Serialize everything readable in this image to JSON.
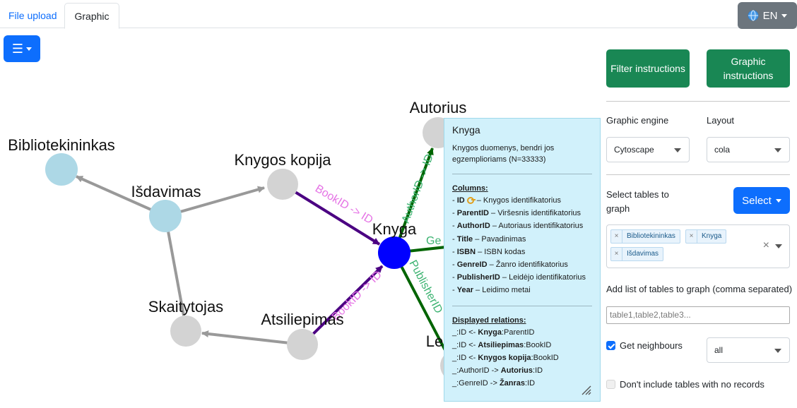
{
  "tabs": [
    {
      "label": "File upload"
    },
    {
      "label": "Graphic"
    }
  ],
  "language": {
    "icon": "globe-icon",
    "label": "EN"
  },
  "menu_button": {
    "icon": "hamburger-icon",
    "label": "☰"
  },
  "graph": {
    "nodes": [
      {
        "label": "Autorius",
        "color": "#d3d3d3"
      },
      {
        "label": "Bibliotekininkas",
        "color": "#add8e6"
      },
      {
        "label": "Knygos kopija",
        "color": "#d3d3d3"
      },
      {
        "label": "Išdavimas",
        "color": "#add8e6"
      },
      {
        "label": "Knyga",
        "color": "#0000ff"
      },
      {
        "label": "Skaitytojas",
        "color": "#d3d3d3"
      },
      {
        "label": "Atsiliepimas",
        "color": "#d3d3d3"
      },
      {
        "label": "Le",
        "color": "#d3d3d3"
      }
    ],
    "edge_labels": [
      {
        "text": "BookID -> ID",
        "color": "#e573e5"
      },
      {
        "text": "AuthorID -> ID",
        "color": "#3cb371"
      },
      {
        "text": "Ge",
        "color": "#3cb371"
      },
      {
        "text": "PublisherID",
        "color": "#3cb371"
      },
      {
        "text": "BookID -> ID",
        "color": "#e573e5"
      }
    ]
  },
  "tooltip": {
    "title": "Knyga",
    "description": "Knygos duomenys, bendri jos egzemplioriams (N=33333)",
    "columns_heading": "Columns:",
    "columns": [
      {
        "name": "ID",
        "desc": "Knygos identifikatorius",
        "key": true
      },
      {
        "name": "ParentID",
        "desc": "Viršesnis identifikatorius"
      },
      {
        "name": "AuthorID",
        "desc": "Autoriaus identifikatorius"
      },
      {
        "name": "Title",
        "desc": "Pavadinimas"
      },
      {
        "name": "ISBN",
        "desc": "ISBN kodas"
      },
      {
        "name": "GenreID",
        "desc": "Žanro identifikatorius"
      },
      {
        "name": "PublisherID",
        "desc": "Leidėjo identifikatorius"
      },
      {
        "name": "Year",
        "desc": "Leidimo metai"
      }
    ],
    "relations_heading": "Displayed relations:",
    "relations": [
      {
        "pre": "_:ID <- ",
        "table": "Knyga",
        "col": ":ParentID"
      },
      {
        "pre": "_:ID <- ",
        "table": "Atsiliepimas",
        "col": ":BookID"
      },
      {
        "pre": "_:ID <- ",
        "table": "Knygos kopija",
        "col": ":BookID"
      },
      {
        "pre": "_:AuthorID -> ",
        "table": "Autorius",
        "col": ":ID"
      },
      {
        "pre": "_:GenreID -> ",
        "table": "Žanras",
        "col": ":ID"
      }
    ]
  },
  "panel": {
    "filter_instructions": "Filter instructions",
    "graphic_instructions": "Graphic instructions",
    "engine_label": "Graphic engine",
    "engine_value": "Cytoscape",
    "layout_label": "Layout",
    "layout_value": "cola",
    "select_tables_label": "Select tables to graph",
    "select_button": "Select",
    "selected_tables": [
      "Bibliotekininkas",
      "Knyga",
      "Išdavimas"
    ],
    "chip_remove": "×",
    "clear_all": "×",
    "add_list_label": "Add list of tables to graph (comma separated)",
    "add_list_placeholder": "table1,table2,table3...",
    "get_neighbours_label": "Get neighbours",
    "get_neighbours_checked": true,
    "neighbours_value": "all",
    "no_records_label": "Don't include tables with no records",
    "no_records_checked": false
  }
}
